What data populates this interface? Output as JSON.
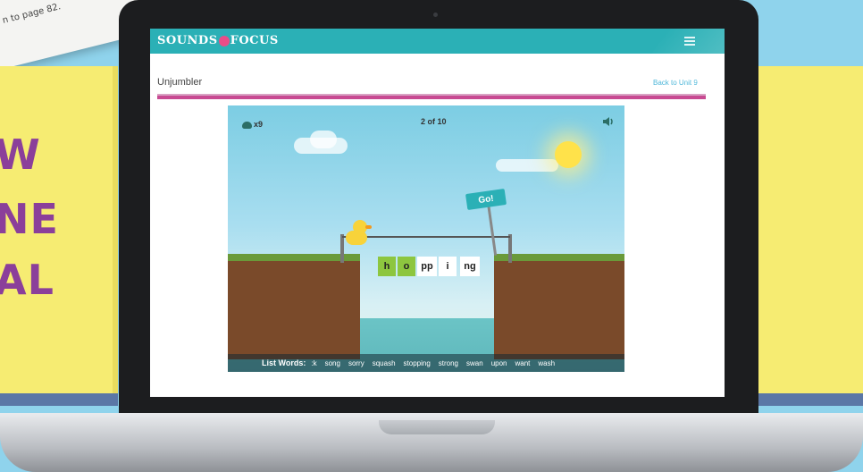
{
  "background": {
    "paper_note": "n to page 82.",
    "promo_lines": [
      "W",
      "NE",
      "AL"
    ]
  },
  "site": {
    "logo_left": "SOUNDS",
    "logo_mid": "IN",
    "logo_right": "FOCUS",
    "menu_icon": "hamburger-menu-icon"
  },
  "page": {
    "title": "Unjumbler",
    "back_link": "Back to Unit 9"
  },
  "game": {
    "duck_count": "x9",
    "progress": "2 of 10",
    "go_label": "Go!",
    "tiles": [
      {
        "text": "h",
        "highlighted": true
      },
      {
        "text": "o",
        "highlighted": true
      },
      {
        "text": "pp",
        "highlighted": false
      },
      {
        "text": "i",
        "highlighted": false
      },
      {
        "text": "ng",
        "highlighted": false
      }
    ],
    "list_label": "List Words:",
    "list_words": [
      ":k",
      "song",
      "sorry",
      "squash",
      "stopping",
      "strong",
      "swan",
      "upon",
      "want",
      "wash"
    ]
  },
  "colors": {
    "brand_teal": "#2bb0b6",
    "accent_magenta": "#c84a92",
    "tile_green": "#8dc63f"
  }
}
